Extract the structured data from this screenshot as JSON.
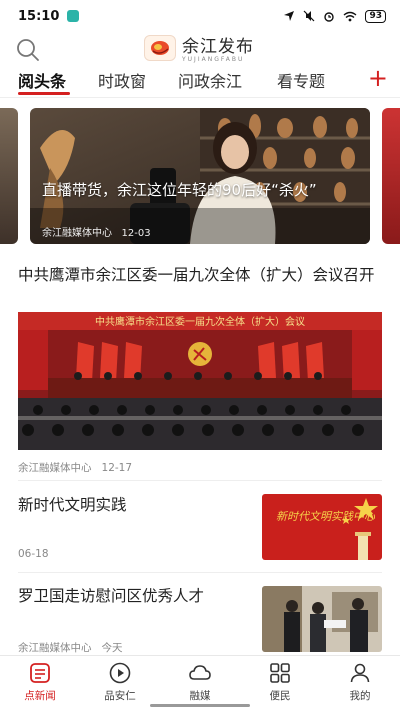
{
  "status_bar": {
    "time": "15:10",
    "battery": "93"
  },
  "header": {
    "logo_cn": "余江发布",
    "logo_en": "YUJIANGFABU",
    "search_icon": "search-icon"
  },
  "tabs": [
    {
      "label": "阅头条",
      "active": true
    },
    {
      "label": "时政窗",
      "active": false
    },
    {
      "label": "问政余江",
      "active": false
    },
    {
      "label": "看专题",
      "active": false
    }
  ],
  "tab_add_label": "+",
  "carousel": {
    "title": "直播带货，余江这位年轻的90后好“杀火”",
    "source": "余江融媒体中心",
    "date": "12-03"
  },
  "news": [
    {
      "title": "中共鹰潭市余江区委一届九次全体（扩大）会议召开",
      "source": "余江融媒体中心",
      "date": "12-17",
      "banner_text": "中共鹰潭市余江区委一届九次全体（扩大）会议"
    },
    {
      "title": "新时代文明实践",
      "source": "",
      "date": "06-18",
      "thumb_text": "新时代文明实践中心"
    },
    {
      "title": "罗卫国走访慰问区优秀人才",
      "source": "余江融媒体中心",
      "date": "今天"
    }
  ],
  "bottom_nav": [
    {
      "label": "点新闻",
      "icon": "news-list-icon",
      "active": true
    },
    {
      "label": "品安仁",
      "icon": "play-circle-icon",
      "active": false
    },
    {
      "label": "融媒",
      "icon": "cloud-icon",
      "active": false
    },
    {
      "label": "便民",
      "icon": "grid-icon",
      "active": false
    },
    {
      "label": "我的",
      "icon": "user-icon",
      "active": false
    }
  ],
  "colors": {
    "accent": "#d42020",
    "text": "#222222",
    "meta": "#888888"
  }
}
